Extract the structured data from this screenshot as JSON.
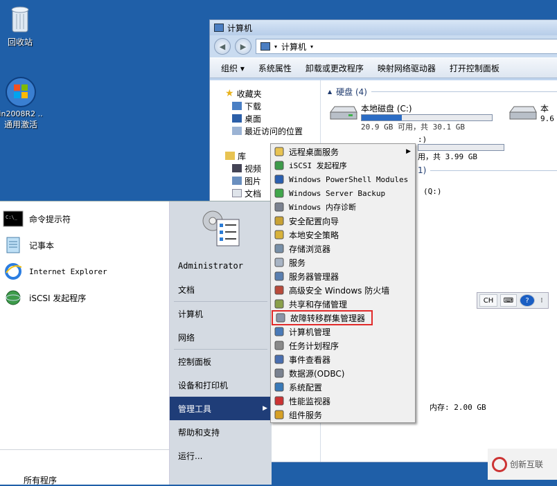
{
  "desktop": {
    "icons": [
      {
        "label": "回收站",
        "icon": "recycle-bin-icon"
      },
      {
        "label_line1": "in2008R2 ..",
        "label_line2": "通用激活",
        "icon": "windows-orb-icon"
      }
    ]
  },
  "explorer": {
    "title": "计算机",
    "address": "计算机",
    "toolbar": [
      "组织 ▾",
      "系统属性",
      "卸载或更改程序",
      "映射网络驱动器",
      "打开控制面板"
    ],
    "nav": {
      "favorites": "收藏夹",
      "fav_items": [
        "下载",
        "桌面",
        "最近访问的位置"
      ],
      "libraries": "库",
      "lib_items": [
        "视频",
        "图片",
        "文档"
      ]
    },
    "hard_disks_header": "硬盘 (4)",
    "drives": [
      {
        "name": "本地磁盘 (C:)",
        "info": "20.9 GB 可用，共 30.1 GB",
        "used_fraction": 0.31
      },
      {
        "name": "本"
      }
    ],
    "drive2_label_tail": ":)",
    "drive2_info_tail": "用，共 3.99 GB",
    "removable_tail": "1)",
    "q_drive": "(Q:)",
    "memory": "内存: 2.00 GB"
  },
  "start_menu": {
    "pinned": [
      {
        "label": "命令提示符",
        "icon": "cmd-icon"
      },
      {
        "label": "记事本",
        "icon": "notepad-icon"
      },
      {
        "label": "Internet Explorer",
        "icon": "ie-icon"
      },
      {
        "label": "iSCSI 发起程序",
        "icon": "iscsi-icon"
      }
    ],
    "all_programs": "所有程序",
    "right": [
      {
        "label": "Administrator"
      },
      {
        "label": "文档"
      },
      {
        "label": "计算机"
      },
      {
        "label": "网络"
      },
      {
        "label": "控制面板"
      },
      {
        "label": "设备和打印机"
      },
      {
        "label": "管理工具"
      },
      {
        "label": "帮助和支持"
      },
      {
        "label": "运行..."
      }
    ]
  },
  "admin_tools": [
    {
      "label": "远程桌面服务",
      "icon": "folder-icon"
    },
    {
      "label": "iSCSI 发起程序",
      "icon": "iscsi-icon"
    },
    {
      "label": "Windows PowerShell Modules",
      "icon": "powershell-icon"
    },
    {
      "label": "Windows Server Backup",
      "icon": "backup-icon"
    },
    {
      "label": "Windows 内存诊断",
      "icon": "memory-diagnostic-icon"
    },
    {
      "label": "安全配置向导",
      "icon": "security-wizard-icon"
    },
    {
      "label": "本地安全策略",
      "icon": "local-security-policy-icon"
    },
    {
      "label": "存储浏览器",
      "icon": "storage-explorer-icon"
    },
    {
      "label": "服务",
      "icon": "services-icon"
    },
    {
      "label": "服务器管理器",
      "icon": "server-manager-icon"
    },
    {
      "label": "高级安全 Windows 防火墙",
      "icon": "firewall-icon"
    },
    {
      "label": "共享和存储管理",
      "icon": "share-storage-icon"
    },
    {
      "label": "故障转移群集管理器",
      "icon": "failover-cluster-icon"
    },
    {
      "label": "计算机管理",
      "icon": "computer-management-icon"
    },
    {
      "label": "任务计划程序",
      "icon": "task-scheduler-icon"
    },
    {
      "label": "事件查看器",
      "icon": "event-viewer-icon"
    },
    {
      "label": "数据源(ODBC)",
      "icon": "odbc-icon"
    },
    {
      "label": "系统配置",
      "icon": "system-config-icon"
    },
    {
      "label": "性能监视器",
      "icon": "performance-monitor-icon"
    },
    {
      "label": "组件服务",
      "icon": "component-services-icon"
    }
  ],
  "langbar": {
    "lang": "CH"
  },
  "watermark": {
    "text": "创新互联"
  },
  "colors": {
    "desktop": "#1f5fa8",
    "highlight_red": "#e12a2a",
    "selected_menu": "#1f3d78"
  }
}
